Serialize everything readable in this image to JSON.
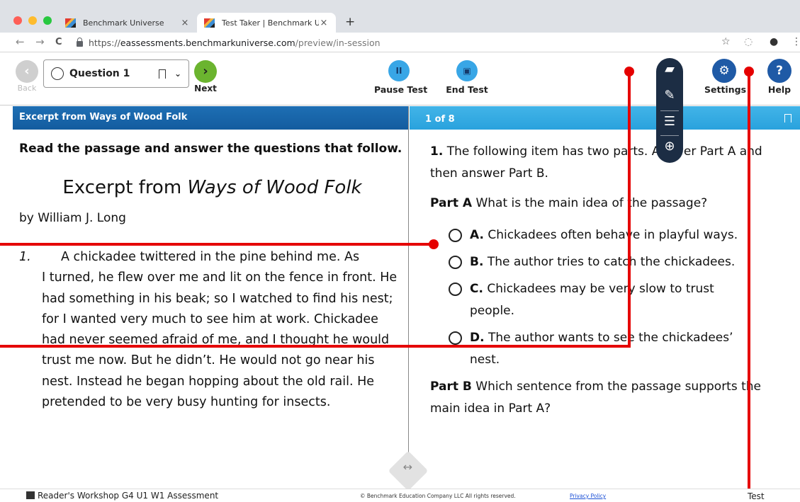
{
  "browser": {
    "tabs": [
      {
        "label": "Benchmark Universe",
        "close": "×"
      },
      {
        "label": "Test Taker | Benchmark Univer",
        "close": "×"
      }
    ],
    "new_tab": "+",
    "url_scheme": "https://",
    "url_host": "eassessments.benchmarkuniverse.com",
    "url_path": "/preview/in-session",
    "nav": {
      "back": "←",
      "forward": "→",
      "reload": "C"
    },
    "right_icons": {
      "star": "☆",
      "ext": "◌",
      "profile": "●",
      "menu": "⋮"
    },
    "traffic_colors": [
      "#fe5f57",
      "#febc2e",
      "#28c840"
    ]
  },
  "toolbar": {
    "back_label": "Back",
    "back_glyph": "‹",
    "question_label": "Question 1",
    "next_label": "Next",
    "next_glyph": "›",
    "pause_label": "Pause Test",
    "pause_glyph": "II",
    "end_label": "End Test",
    "end_glyph": "▣",
    "settings_label": "Settings",
    "settings_glyph": "⚙",
    "help_label": "Help",
    "help_glyph": "?"
  },
  "sidetools": {
    "briefcase": "▰",
    "pencil": "✎",
    "line": "☰",
    "zoom": "⊕"
  },
  "passage": {
    "header": "Excerpt from Ways of Wood Folk",
    "instructions": "Read the passage and answer the questions that follow.",
    "title_prefix": "Excerpt from ",
    "title_italic": "Ways of Wood Folk",
    "byline": "by William J. Long",
    "para_number": "1.",
    "para_first": "A chickadee twittered in the pine behind me. As",
    "para_rest": "I turned, he flew over me and lit on the fence in front. He had something in his beak; so I watched to find his nest; for I wanted very much to see him at work. Chickadee had never seemed afraid of me, and I thought he would trust me now. But he didn’t. He would not go near his nest. Instead he began hopping about the old rail. He pretended to be very busy hunting for insects."
  },
  "question": {
    "counter": "1 of 8",
    "number": "1.",
    "stem": "The following item has two parts. Answer Part A and then answer Part B.",
    "part_a_label": "Part A",
    "part_a_text": "What is the main idea of the passage?",
    "choices": [
      {
        "letter": "A.",
        "text": "Chickadees often behave in playful ways."
      },
      {
        "letter": "B.",
        "text": "The author tries to catch the chickadees."
      },
      {
        "letter": "C.",
        "text": "Chickadees may be very slow to trust people."
      },
      {
        "letter": "D.",
        "text": "The author wants to see the chickadees’ nest."
      }
    ],
    "part_b_label": "Part B",
    "part_b_text": "Which sentence from the passage supports the main idea in Part A?"
  },
  "footer": {
    "left": "Reader's Workshop G4 U1 W1 Assessment",
    "center": "© Benchmark Education Company LLC All rights reserved.",
    "privacy": "Privacy Policy",
    "right": "Test Preview"
  },
  "colors": {
    "annotation_red": "#e50000",
    "passage_header": "#1a67ad",
    "question_header": "#35abe3",
    "next_green": "#6bb42f",
    "tool_blue": "#38a6e6",
    "settings_blue": "#1f5aa6",
    "sidetools_bg": "#1c2d44"
  }
}
